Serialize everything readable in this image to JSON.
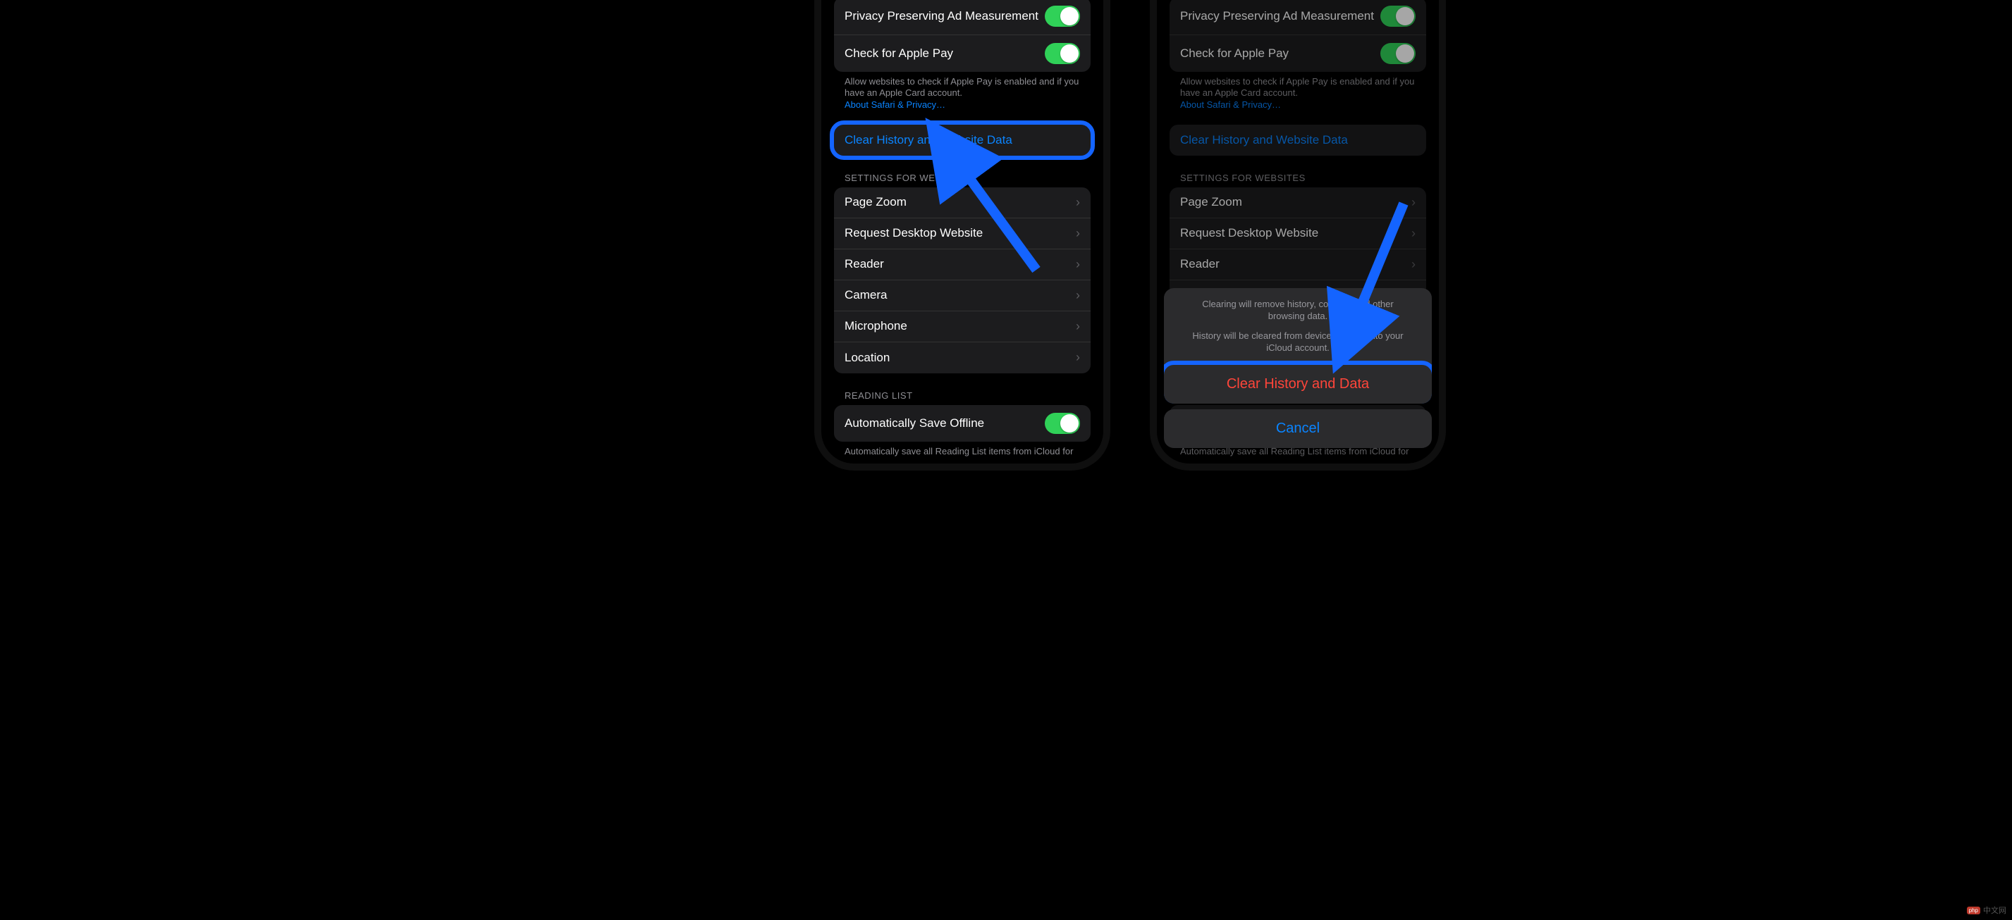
{
  "settings": {
    "privacy_ad_label": "Privacy Preserving Ad Measurement",
    "apple_pay_label": "Check for Apple Pay",
    "apple_pay_footer": "Allow websites to check if Apple Pay is enabled and if you have an Apple Card account.",
    "about_link_label": "About Safari & Privacy…",
    "clear_history_label": "Clear History and Website Data",
    "websites_header": "SETTINGS FOR WEBSITES",
    "website_items": {
      "page_zoom": "Page Zoom",
      "request_desktop": "Request Desktop Website",
      "reader": "Reader",
      "camera": "Camera",
      "microphone": "Microphone",
      "location": "Location"
    },
    "reading_header": "READING LIST",
    "auto_offline_label": "Automatically Save Offline",
    "reading_footer": "Automatically save all Reading List items from iCloud for offline reading."
  },
  "sheet": {
    "line1": "Clearing will remove history, cookies, and other browsing data.",
    "line2": "History will be cleared from devices signed into your iCloud account.",
    "action_label": "Clear History and Data",
    "cancel_label": "Cancel"
  },
  "brand": {
    "logo_text": "php",
    "site_text": "中文网"
  }
}
